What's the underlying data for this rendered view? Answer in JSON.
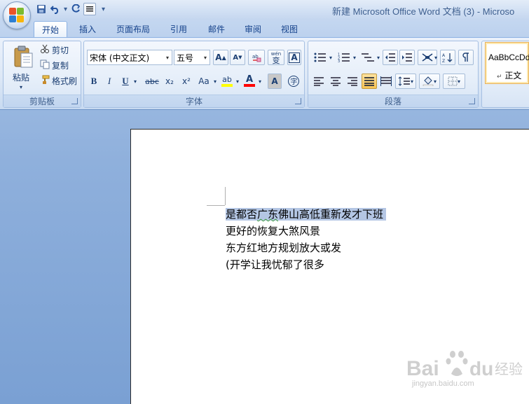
{
  "window": {
    "title": "新建 Microsoft Office Word 文档 (3) - Microso"
  },
  "quick_access": {
    "save_icon": "save-icon",
    "undo_icon": "undo-icon",
    "redo_icon": "redo-icon",
    "format_icon": "format-icon"
  },
  "tabs": [
    {
      "label": "开始",
      "active": true
    },
    {
      "label": "插入"
    },
    {
      "label": "页面布局"
    },
    {
      "label": "引用"
    },
    {
      "label": "邮件"
    },
    {
      "label": "审阅"
    },
    {
      "label": "视图"
    }
  ],
  "clipboard": {
    "paste_label": "粘贴",
    "cut_label": "剪切",
    "copy_label": "复制",
    "format_painter_label": "格式刷",
    "group_label": "剪贴板"
  },
  "font": {
    "font_name": "宋体 (中文正文)",
    "font_size": "五号",
    "group_label": "字体",
    "grow_label": "A",
    "shrink_label": "A",
    "bold": "B",
    "italic": "I",
    "underline": "U",
    "strike": "abc",
    "subscript": "x₂",
    "superscript": "x²",
    "change_case": "Aa",
    "highlight": "ab",
    "font_color": "A",
    "char_shading": "A",
    "phonetic": "wén",
    "phonetic_char": "变"
  },
  "paragraph": {
    "group_label": "段落"
  },
  "styles": {
    "preview": "AaBbCcDd",
    "name": "正文"
  },
  "document": {
    "lines": [
      "是都否广东佛山高低重新发才下班",
      "更好的恢复大煞风景",
      "东方红地方规划放大或发",
      "(开学让我忧郁了很多"
    ]
  },
  "watermark": {
    "brand": "Baidu经验",
    "url": "jingyan.baidu.com"
  },
  "colors": {
    "accent": "#15428b",
    "selection": "#b4c6e4",
    "highlight_yellow": "#ffff00",
    "font_red": "#ff0000"
  }
}
